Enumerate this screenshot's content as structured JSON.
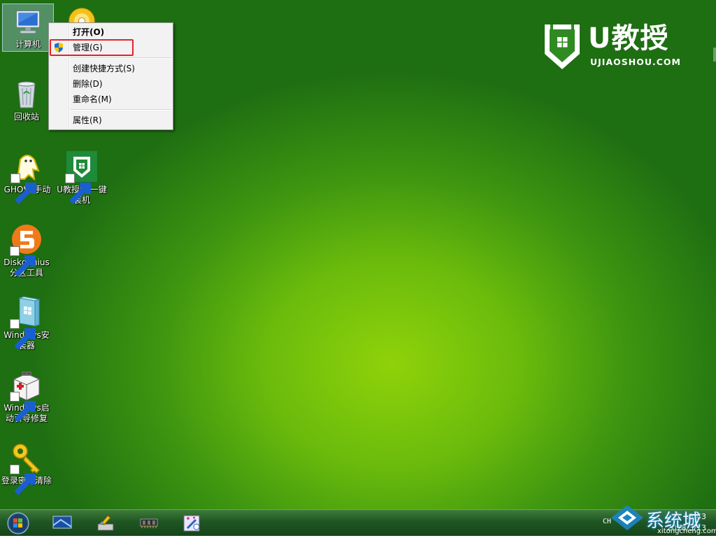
{
  "desktop": {
    "icons": [
      {
        "id": "computer",
        "label": "计算机",
        "icon": "computer-icon"
      },
      {
        "id": "disc",
        "label": "",
        "icon": "disc-icon"
      },
      {
        "id": "recycle",
        "label": "回收站",
        "icon": "recycle-bin-icon"
      },
      {
        "id": "ghost",
        "label": "GHOST手动",
        "icon": "ghost-icon"
      },
      {
        "id": "ujiaoshou",
        "label": "U教授PE一键装机",
        "icon": "ujiaoshou-icon"
      },
      {
        "id": "diskgenius",
        "label": "Diskgenius分区工具",
        "icon": "diskgenius-icon"
      },
      {
        "id": "wininstaller",
        "label": "Windows安装器",
        "icon": "windows-installer-icon"
      },
      {
        "id": "bootrepair",
        "label": "Windows启动引导修复",
        "icon": "toolbox-icon"
      },
      {
        "id": "passwordclear",
        "label": "登录密码清除",
        "icon": "key-icon"
      }
    ]
  },
  "context_menu": {
    "open": "打开(O)",
    "manage": "管理(G)",
    "create_shortcut": "创建快捷方式(S)",
    "delete": "删除(D)",
    "rename": "重命名(M)",
    "properties": "属性(R)"
  },
  "logo": {
    "name": "U教授",
    "url": "UJIAOSHOU.COM"
  },
  "taskbar": {
    "apps": [
      "display-icon",
      "brush-icon",
      "memory-chip-icon",
      "magic-wand-icon"
    ],
    "lang": "CH",
    "time": "13:43",
    "date": "2018/3/13"
  },
  "watermark": {
    "text": "系统城",
    "sub": "xitongcheng.com"
  },
  "colors": {
    "desktop_green": "#6bbb0c",
    "highlight_red": "#e8202a",
    "taskbar_green": "#1f5623"
  }
}
